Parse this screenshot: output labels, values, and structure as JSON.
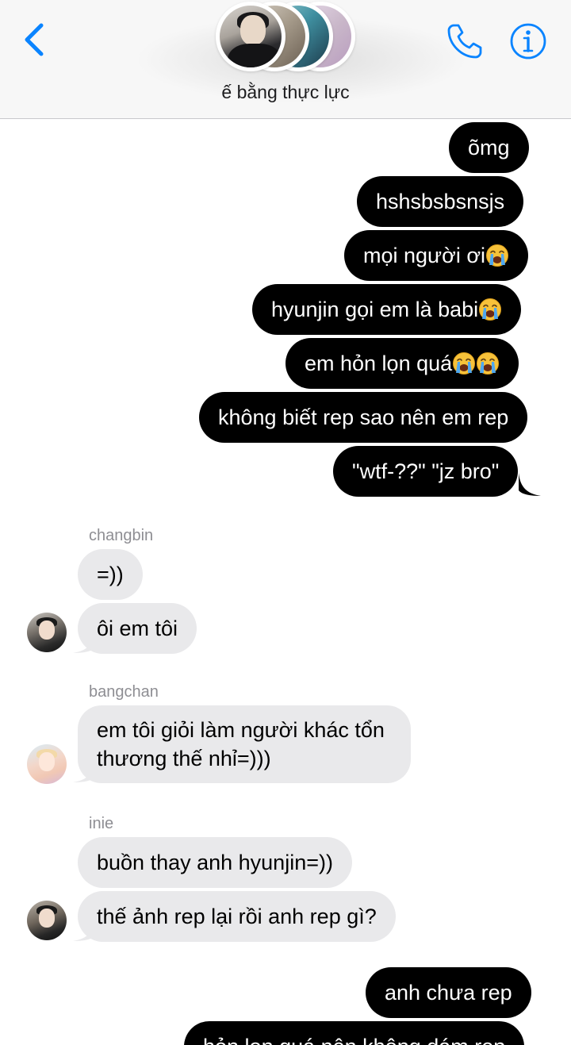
{
  "header": {
    "group_name": "ế bằng thực lực",
    "icons": {
      "back": "chevron-left-icon",
      "call": "phone-icon",
      "info": "info-icon"
    },
    "accent_color": "#0a84ff"
  },
  "messages": {
    "outgoing_1": [
      {
        "text": "õmg"
      },
      {
        "text": "hshsbsbsnsjs"
      },
      {
        "text": "mọi người ơi",
        "emoji": "crying-face-icon"
      },
      {
        "text": "hyunjin gọi em là babi",
        "emoji": "crying-face-icon"
      },
      {
        "text": "em hỏn lọn quá",
        "emoji": "crying-face-icon"
      },
      {
        "text": "không biết rep sao nên em rep"
      },
      {
        "text": "\"wtf-??\" \"jz bro\""
      }
    ],
    "changbin": {
      "sender": "changbin",
      "lines": [
        "=))",
        "ôi em tôi"
      ]
    },
    "bangchan": {
      "sender": "bangchan",
      "lines": [
        "em tôi giỏi làm người khác tổn thương thế nhỉ=)))"
      ]
    },
    "inie": {
      "sender": "inie",
      "lines": [
        "buồn thay anh hyunjin=))",
        "thế ảnh rep lại rồi anh rep gì?"
      ]
    },
    "outgoing_2": [
      {
        "text": "anh chưa rep"
      },
      {
        "text": "hỏn lọn quá nên không dám rep"
      }
    ]
  },
  "colors": {
    "outgoing_bubble": "#000000",
    "incoming_bubble": "#e9e9eb",
    "sender_label": "#8e8e93"
  }
}
